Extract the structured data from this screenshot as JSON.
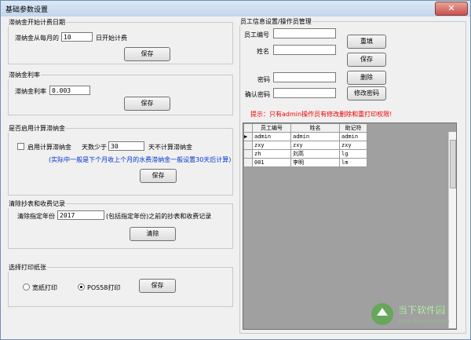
{
  "window": {
    "title": "基础参数设置",
    "close_glyph": "✕"
  },
  "start_date": {
    "group_title": "滞纳金开始计费日期",
    "label_prefix": "滞纳金从每月的",
    "day_value": "10",
    "label_suffix": "日开始计费",
    "save_label": "保存"
  },
  "rate": {
    "group_title": "滞纳金利率",
    "label": "滞纳金利率",
    "value": "0.003",
    "save_label": "保存"
  },
  "enable": {
    "group_title": "是否启用计算滞纳金",
    "checkbox_label": "启用计算滞纳金",
    "checked": false,
    "days_prefix": "天数少于",
    "days_value": "30",
    "days_suffix": "天不计算滞纳金",
    "note": "(实际中一般是下个月收上个月的水费滞纳金一般设置30天后计算)",
    "save_label": "保存"
  },
  "clear": {
    "group_title": "清除抄表和收费记录",
    "label_prefix": "清除指定年份",
    "year_value": "2017",
    "label_suffix": "(包括指定年份)之前的抄表和收费记录",
    "clear_label": "清除"
  },
  "print": {
    "group_title": "选择打印纸张",
    "option_wide": "宽纸打印",
    "option_pos": "POS58打印",
    "selected": "POS58打印",
    "save_label": "保存"
  },
  "staff": {
    "group_title": "员工信息设置/操作员管理",
    "id_label": "员工编号",
    "name_label": "姓名",
    "password_label": "密码",
    "confirm_label": "确认密码",
    "id_value": "",
    "name_value": "",
    "password_value": "",
    "confirm_value": "",
    "refill_label": "重填",
    "save_label": "保存",
    "delete_label": "删除",
    "change_pw_label": "修改密码",
    "tip": "提示：只有admin操作员有修改删除和重打印权限!"
  },
  "table": {
    "columns": [
      "员工编号",
      "姓名",
      "助记符"
    ],
    "rows": [
      [
        "admin",
        "admin",
        "admin"
      ],
      [
        "zxy",
        "zxy",
        "zxy"
      ],
      [
        "zh",
        "刘高",
        "lg"
      ],
      [
        "001",
        "李明",
        "lm"
      ]
    ],
    "current_row_indicator": "▶"
  },
  "colors": {
    "note": "#0033cc",
    "tip": "#ee0000",
    "accent": "#4fa83d"
  },
  "watermark": {
    "main": "当下软件园",
    "sub": "www.downxia.com"
  }
}
